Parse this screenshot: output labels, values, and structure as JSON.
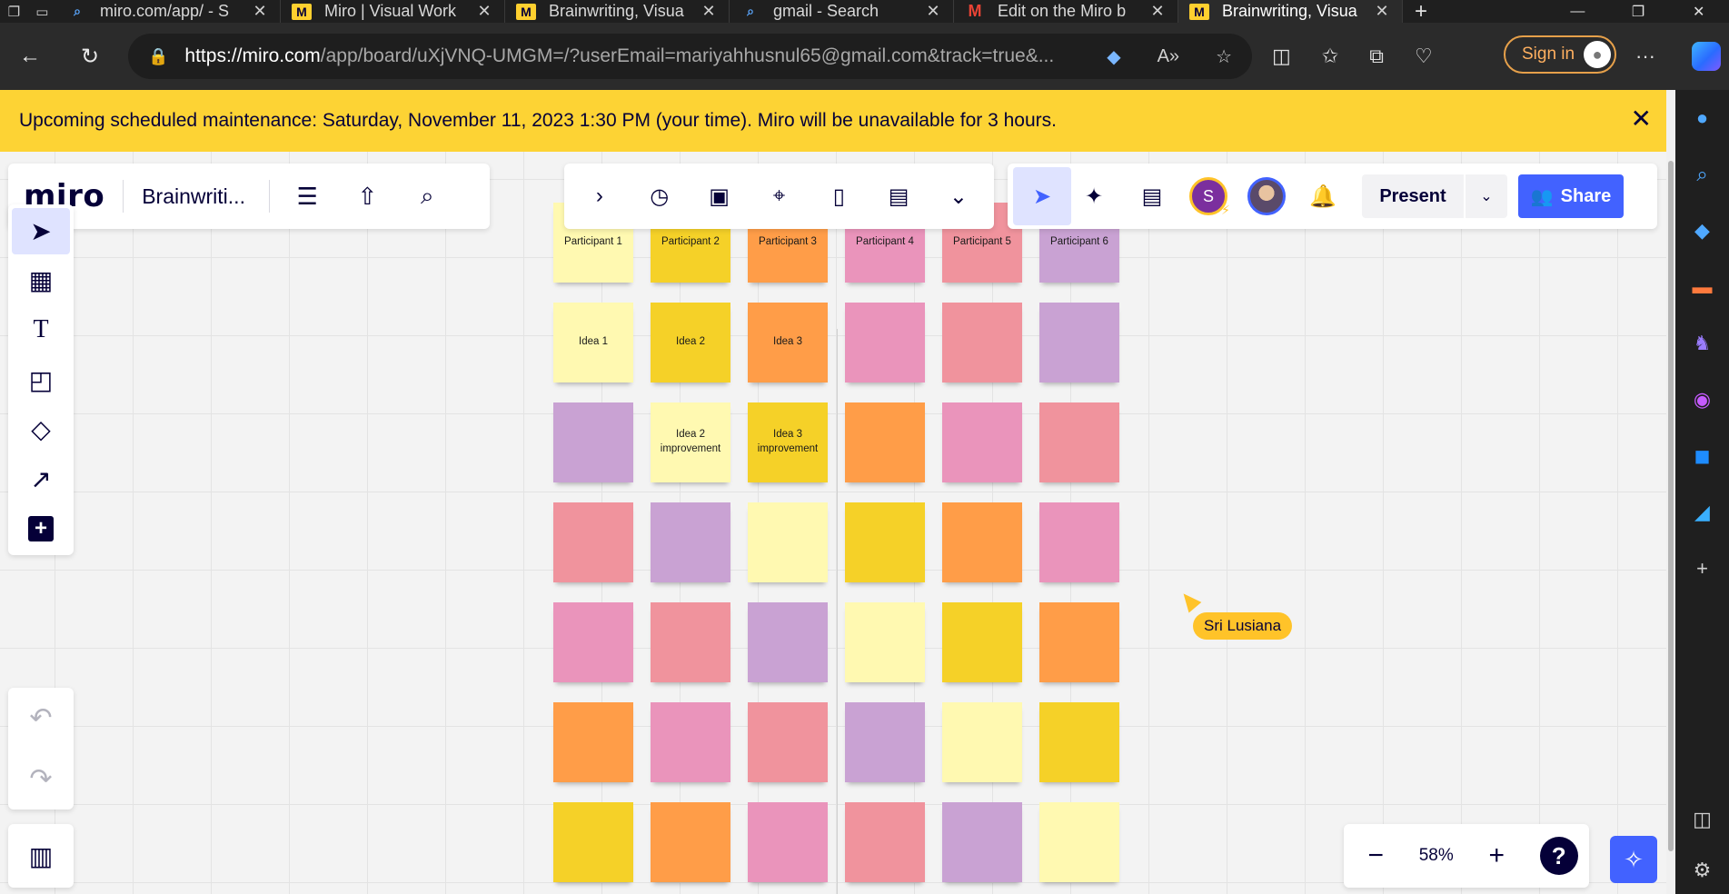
{
  "browser": {
    "tabs": [
      {
        "label": "miro.com/app/ - S",
        "icon": "search-icon",
        "active": false
      },
      {
        "label": "Miro | Visual Work",
        "icon": "miro-logo-icon",
        "active": false
      },
      {
        "label": "Brainwriting, Visua",
        "icon": "miro-logo-icon",
        "active": false
      },
      {
        "label": "gmail - Search",
        "icon": "search-icon",
        "active": false
      },
      {
        "label": "Edit on the Miro b",
        "icon": "gmail-icon",
        "active": false
      },
      {
        "label": "Brainwriting, Visua",
        "icon": "miro-logo-icon",
        "active": true
      }
    ],
    "url_host": "https://miro.com",
    "url_rest": "/app/board/uXjVNQ-UMGM=/?userEmail=mariyahhusnul65@gmail.com&track=true&...",
    "signin_label": "Sign in"
  },
  "banner": {
    "text": "Upcoming scheduled maintenance: Saturday, November 11, 2023 1:30 PM (your time). Miro will be unavailable for 3 hours."
  },
  "board": {
    "logo": "miro",
    "name": "Brainwriti...",
    "present_label": "Present",
    "share_label": "Share",
    "user_initial": "S",
    "zoom": "58%",
    "help": "?"
  },
  "collaborator": {
    "name": "Sri Lusiana",
    "color": "#ffc329"
  },
  "colors": {
    "light_yellow": "#fff9b1",
    "yellow": "#f5d128",
    "orange": "#ff9d48",
    "pink": "#ea94bb",
    "red": "#f0939d",
    "violet": "#c9a2d3",
    "accent": "#4262ff"
  },
  "stickies": [
    [
      {
        "text": "Participant 1",
        "color": "light_yellow"
      },
      {
        "text": "Participant 2",
        "color": "yellow"
      },
      {
        "text": "Participant 3",
        "color": "orange"
      },
      {
        "text": "Participant 4",
        "color": "pink"
      },
      {
        "text": "Participant 5",
        "color": "red"
      },
      {
        "text": "Participant 6",
        "color": "violet"
      }
    ],
    [
      {
        "text": "Idea 1",
        "color": "light_yellow"
      },
      {
        "text": "Idea 2",
        "color": "yellow"
      },
      {
        "text": "Idea 3",
        "color": "orange"
      },
      {
        "text": "",
        "color": "pink"
      },
      {
        "text": "",
        "color": "red"
      },
      {
        "text": "",
        "color": "violet"
      }
    ],
    [
      {
        "text": "",
        "color": "violet"
      },
      {
        "text": "Idea 2 improvement",
        "color": "light_yellow"
      },
      {
        "text": "Idea 3 improvement",
        "color": "yellow"
      },
      {
        "text": "",
        "color": "orange"
      },
      {
        "text": "",
        "color": "pink"
      },
      {
        "text": "",
        "color": "red"
      }
    ],
    [
      {
        "text": "",
        "color": "red"
      },
      {
        "text": "",
        "color": "violet"
      },
      {
        "text": "",
        "color": "light_yellow"
      },
      {
        "text": "",
        "color": "yellow"
      },
      {
        "text": "",
        "color": "orange"
      },
      {
        "text": "",
        "color": "pink"
      }
    ],
    [
      {
        "text": "",
        "color": "pink"
      },
      {
        "text": "",
        "color": "red"
      },
      {
        "text": "",
        "color": "violet"
      },
      {
        "text": "",
        "color": "light_yellow"
      },
      {
        "text": "",
        "color": "yellow"
      },
      {
        "text": "",
        "color": "orange"
      }
    ],
    [
      {
        "text": "",
        "color": "orange"
      },
      {
        "text": "",
        "color": "pink"
      },
      {
        "text": "",
        "color": "red"
      },
      {
        "text": "",
        "color": "violet"
      },
      {
        "text": "",
        "color": "light_yellow"
      },
      {
        "text": "",
        "color": "yellow"
      }
    ],
    [
      {
        "text": "",
        "color": "yellow"
      },
      {
        "text": "",
        "color": "orange"
      },
      {
        "text": "",
        "color": "pink"
      },
      {
        "text": "",
        "color": "red"
      },
      {
        "text": "",
        "color": "violet"
      },
      {
        "text": "",
        "color": "light_yellow"
      }
    ]
  ]
}
